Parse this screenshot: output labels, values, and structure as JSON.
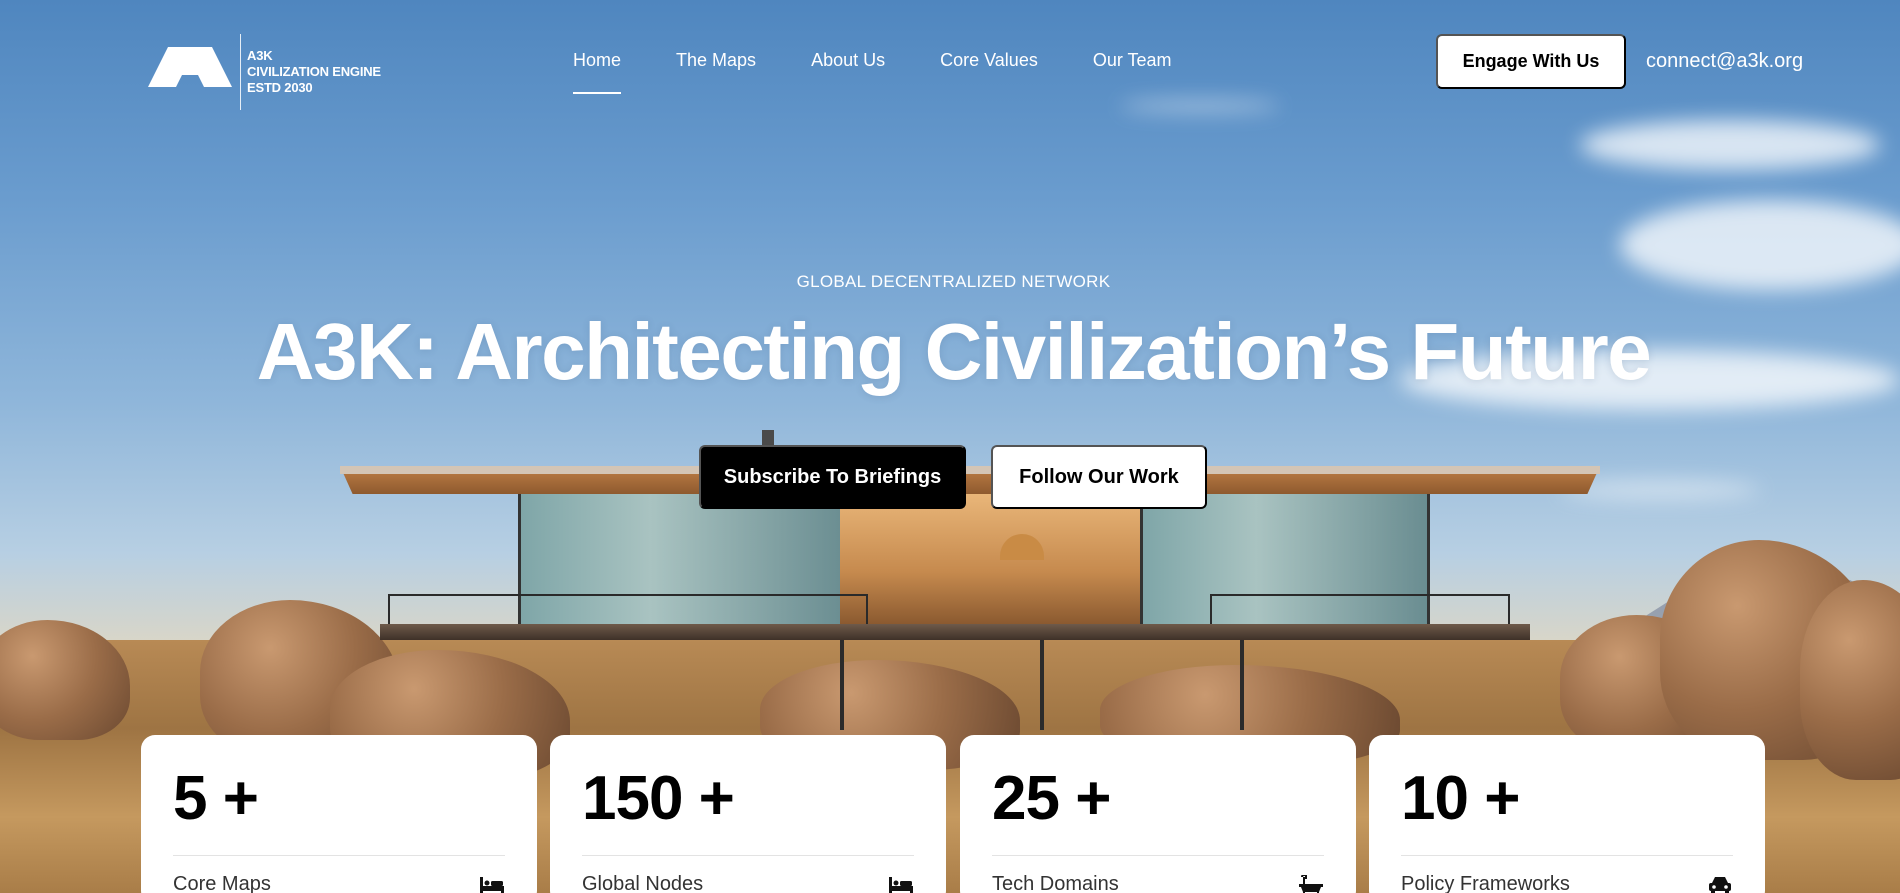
{
  "brand": {
    "line1": "A3K",
    "line2": "CIVILIZATION ENGINE",
    "line3": "ESTD 2030"
  },
  "nav": {
    "items": [
      {
        "label": "Home",
        "active": true
      },
      {
        "label": "The Maps",
        "active": false
      },
      {
        "label": "About Us",
        "active": false
      },
      {
        "label": "Core Values",
        "active": false
      },
      {
        "label": "Our Team",
        "active": false
      }
    ],
    "cta_label": "Engage With Us",
    "email": "connect@a3k.org"
  },
  "hero": {
    "eyebrow": "GLOBAL DECENTRALIZED NETWORK",
    "headline": "A3K: Architecting Civilization’s Future",
    "primary_button": "Subscribe To Briefings",
    "secondary_button": "Follow Our Work"
  },
  "stats": [
    {
      "value": "5 +",
      "label": "Core Maps",
      "icon": "bed-icon"
    },
    {
      "value": "150 +",
      "label": "Global Nodes",
      "icon": "bed-icon"
    },
    {
      "value": "25 +",
      "label": "Tech Domains",
      "icon": "bathtub-icon"
    },
    {
      "value": "10 +",
      "label": "Policy Frameworks",
      "icon": "car-icon"
    }
  ],
  "colors": {
    "sky": "#6a9cce",
    "button_dark": "#000000",
    "button_light": "#ffffff"
  }
}
